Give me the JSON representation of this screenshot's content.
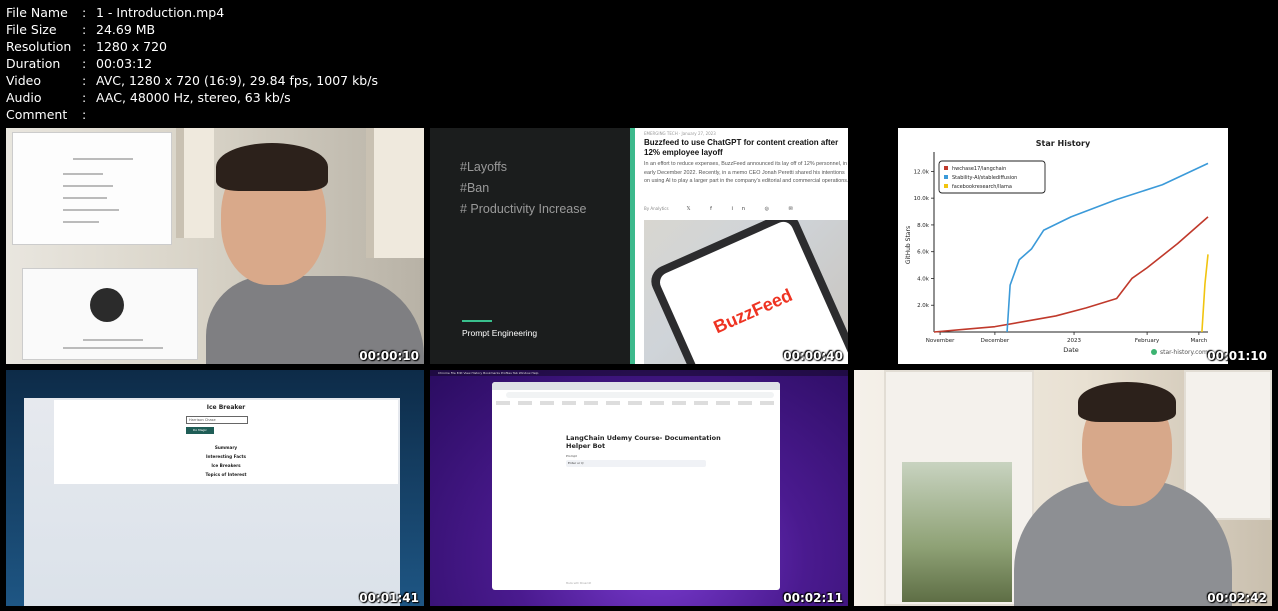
{
  "meta": [
    {
      "key": "File Name",
      "value": "1 - Introduction.mp4"
    },
    {
      "key": "File Size",
      "value": "24.69 MB"
    },
    {
      "key": "Resolution",
      "value": "1280 x 720"
    },
    {
      "key": "Duration",
      "value": "00:03:12"
    },
    {
      "key": "Video",
      "value": "AVC, 1280 x 720 (16:9), 29.84 fps, 1007 kb/s"
    },
    {
      "key": "Audio",
      "value": "AAC, 48000 Hz, stereo, 63 kb/s"
    },
    {
      "key": "Comment",
      "value": ""
    }
  ],
  "separator": ":",
  "thumbnails": [
    {
      "timestamp": "00:00:10"
    },
    {
      "timestamp": "00:00:40",
      "tags": [
        "#Layoffs",
        "#Ban",
        "# Productivity Increase"
      ],
      "footer": "Prompt Engineering",
      "article": {
        "category": "EMERGING TECH  ·  January 27, 2023",
        "headline": "Buzzfeed to use ChatGPT for content creation after 12% employee layoff",
        "body": "In an effort to reduce expenses, BuzzFeed announced its lay off of 12% personnel, in early December 2022. Recently, in a memo CEO Jonah Peretti shared his intentions on using AI to play a larger part in the company's editorial and commercial operations.",
        "byline": "By Analytics",
        "share_icons": "𝕏 f in ◎ ✉",
        "phone_brand": "BuzzFeed"
      }
    },
    {
      "timestamp": "00:01:10"
    },
    {
      "timestamp": "00:01:41",
      "title": "Ice Breaker",
      "input_value": "Harrison Chase",
      "button_label": "Do Magic",
      "items": [
        "Summary",
        "Interesting Facts",
        "Ice Breakers",
        "Topics of Interest"
      ]
    },
    {
      "timestamp": "00:02:11",
      "menubar": "  Chrome   File   Edit   View   History   Bookmarks   Profiles   Tab   Window   Help",
      "title": "LangChain Udemy Course- Documentation Helper Bot",
      "prompt_label": "Prompt",
      "prompt_value": "Enter ur Q",
      "footer": "Made with Streamlit"
    },
    {
      "timestamp": "00:02:42"
    }
  ],
  "chart_data": {
    "type": "line",
    "title": "Star History",
    "xlabel": "Date",
    "ylabel": "GitHub Stars",
    "x_ticks": [
      "November",
      "December",
      "2023",
      "February",
      "March"
    ],
    "y_ticks": [
      "2.0k",
      "4.0k",
      "6.0k",
      "8.0k",
      "10.0k",
      "12.0k"
    ],
    "ylim": [
      0,
      13000
    ],
    "legend_position": "top-left",
    "watermark": "star-history.com",
    "series": [
      {
        "name": "hwchase17/langchain",
        "color": "#c0392b",
        "x": [
          0,
          1,
          2,
          3,
          4,
          5,
          6,
          6.5,
          7,
          8,
          9
        ],
        "y": [
          0,
          200,
          400,
          800,
          1200,
          1800,
          2500,
          4000,
          4800,
          6600,
          8600
        ]
      },
      {
        "name": "Stability-AI/stablediffusion",
        "color": "#3b9ad9",
        "x": [
          2.4,
          2.5,
          2.8,
          3.2,
          3.6,
          4.5,
          6,
          7.5,
          9
        ],
        "y": [
          0,
          3500,
          5400,
          6200,
          7600,
          8600,
          9900,
          11000,
          12600
        ]
      },
      {
        "name": "facebookresearch/llama",
        "color": "#f1c40f",
        "x": [
          8.8,
          8.9,
          9.0
        ],
        "y": [
          0,
          3600,
          5800
        ]
      }
    ]
  }
}
